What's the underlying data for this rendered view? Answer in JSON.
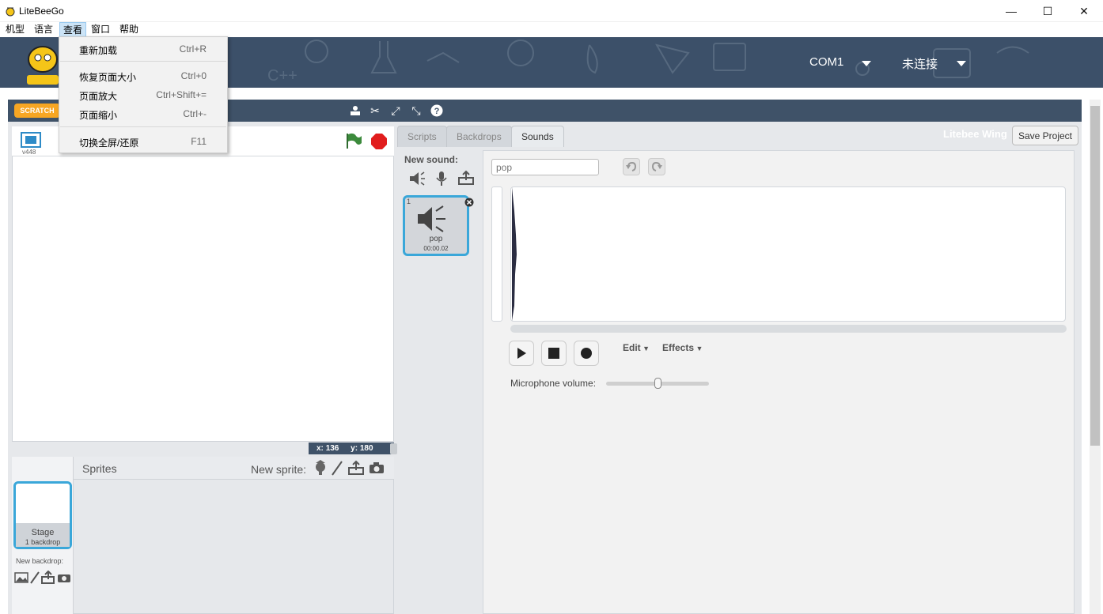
{
  "window": {
    "title": "LiteBeeGo",
    "minimize": "—",
    "maximize": "☐",
    "close": "✕"
  },
  "menubar": [
    "机型",
    "语言",
    "查看",
    "窗口",
    "帮助"
  ],
  "header": {
    "port": "COM1",
    "status": "未连接"
  },
  "dropdown": {
    "items": [
      {
        "label": "重新加载",
        "shortcut": "Ctrl+R"
      },
      {
        "label": "恢复页面大小",
        "shortcut": "Ctrl+0"
      },
      {
        "label": "页面放大",
        "shortcut": "Ctrl+Shift+="
      },
      {
        "label": "页面缩小",
        "shortcut": "Ctrl+-"
      },
      {
        "label": "切换全屏/还原",
        "shortcut": "F11"
      }
    ]
  },
  "stage": {
    "version": "v448",
    "x_label": "x:",
    "x": "136",
    "y_label": "y:",
    "y": "180"
  },
  "sprites": {
    "title": "Sprites",
    "new_sprite": "New sprite:",
    "stage_name": "Stage",
    "stage_backdrops": "1 backdrop",
    "new_backdrop": "New backdrop:"
  },
  "tabs": [
    "Scripts",
    "Backdrops",
    "Sounds"
  ],
  "right_header": {
    "device": "Litebee Wing",
    "save": "Save Project"
  },
  "sounds": {
    "new_sound": "New sound:",
    "item": {
      "index": "1",
      "name": "pop",
      "duration": "00:00.02"
    },
    "name_value": "pop",
    "edit": "Edit",
    "effects": "Effects",
    "mic_label": "Microphone volume:",
    "mic_level": 0.5
  },
  "colors": {
    "header": "#3c5069",
    "accent": "#3aa7d9"
  }
}
